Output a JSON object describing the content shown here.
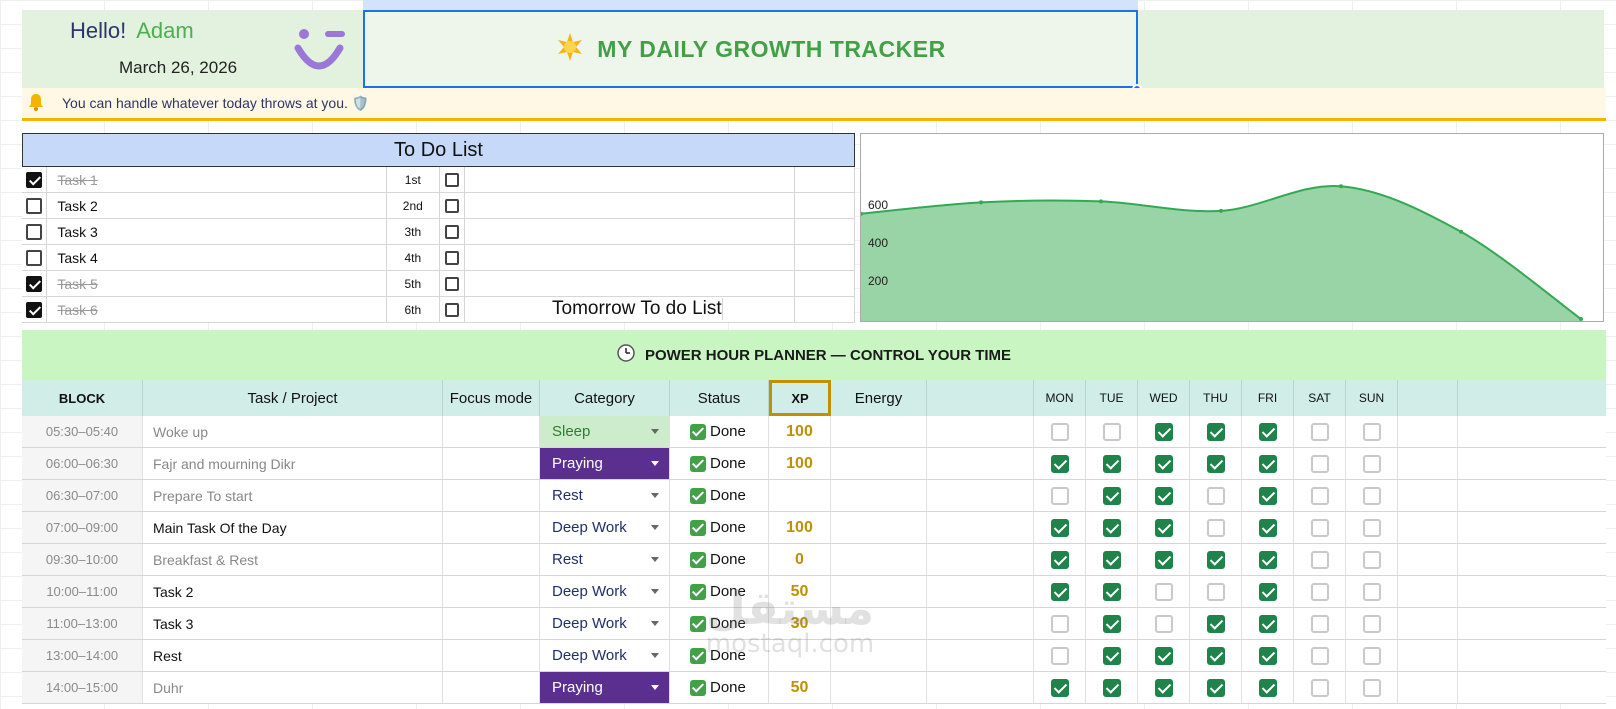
{
  "header": {
    "greeting": "Hello!",
    "name": "Adam",
    "date": "March 26, 2026",
    "title": "MY DAILY GROWTH TRACKER",
    "title_icon": "sun-icon",
    "motivation": "You can handle whatever today throws at you. 🛡️"
  },
  "todo": {
    "title": "To Do List",
    "tomorrow_title": "Tomorrow To do List",
    "items": [
      {
        "label": "Task 1",
        "order": "1st",
        "done": true
      },
      {
        "label": "Task 2",
        "order": "2nd",
        "done": false
      },
      {
        "label": "Task 3",
        "order": "3th",
        "done": false
      },
      {
        "label": "Task 4",
        "order": "4th",
        "done": false
      },
      {
        "label": "Task 5",
        "order": "5th",
        "done": true
      },
      {
        "label": "Task 6",
        "order": "6th",
        "done": true
      }
    ]
  },
  "chart_data": {
    "type": "area",
    "x": [
      1,
      2,
      3,
      4,
      5,
      6,
      7
    ],
    "series": [
      {
        "values": [
          555,
          615,
          620,
          570,
          700,
          460,
          0
        ]
      }
    ],
    "yticks": [
      "200",
      "400",
      "600"
    ],
    "ylim": [
      0,
      800
    ],
    "grid": false,
    "colors": {
      "fill": "#98d4a6",
      "line": "#34a853"
    }
  },
  "planner": {
    "banner": "POWER HOUR PLANNER  —  CONTROL YOUR TIME",
    "banner_icon": "clock-icon",
    "columns": {
      "block": "BLOCK",
      "task": "Task / Project",
      "focus": "Focus mode",
      "category": "Category",
      "status": "Status",
      "xp": "XP",
      "energy": "Energy",
      "days": [
        "MON",
        "TUE",
        "WED",
        "THU",
        "FRI",
        "SAT",
        "SUN"
      ]
    },
    "rows": [
      {
        "block": "05:30–05:40",
        "task": "Woke up",
        "strong": false,
        "category": "Sleep",
        "cat_style": "sleep",
        "status": "Done",
        "xp": "100",
        "days": [
          false,
          false,
          true,
          true,
          true,
          false,
          false
        ]
      },
      {
        "block": "06:00–06:30",
        "task": "Fajr and mourning Dikr",
        "strong": false,
        "category": "Praying",
        "cat_style": "praying",
        "status": "Done",
        "xp": "100",
        "days": [
          true,
          true,
          true,
          true,
          true,
          false,
          false
        ]
      },
      {
        "block": "06:30–07:00",
        "task": "Prepare To start",
        "strong": false,
        "category": "Rest",
        "cat_style": "plain",
        "status": "Done",
        "xp": "",
        "days": [
          false,
          true,
          true,
          false,
          true,
          false,
          false
        ]
      },
      {
        "block": "07:00–09:00",
        "task": "Main Task Of the Day",
        "strong": true,
        "category": "Deep Work",
        "cat_style": "plain",
        "status": "Done",
        "xp": "100",
        "days": [
          true,
          true,
          true,
          false,
          true,
          false,
          false
        ]
      },
      {
        "block": "09:30–10:00",
        "task": "Breakfast & Rest",
        "strong": false,
        "category": "Rest",
        "cat_style": "plain",
        "status": "Done",
        "xp": "0",
        "days": [
          true,
          true,
          true,
          true,
          true,
          false,
          false
        ]
      },
      {
        "block": "10:00–11:00",
        "task": "Task 2",
        "strong": true,
        "category": "Deep Work",
        "cat_style": "plain",
        "status": "Done",
        "xp": "50",
        "days": [
          true,
          true,
          false,
          false,
          true,
          false,
          false
        ]
      },
      {
        "block": "11:00–13:00",
        "task": "Task 3",
        "strong": true,
        "category": "Deep Work",
        "cat_style": "plain",
        "status": "Done",
        "xp": "30",
        "days": [
          false,
          true,
          false,
          true,
          true,
          false,
          false
        ]
      },
      {
        "block": "13:00–14:00",
        "task": "Rest",
        "strong": true,
        "category": "Deep Work",
        "cat_style": "plain",
        "status": "Done",
        "xp": "",
        "days": [
          false,
          true,
          true,
          true,
          true,
          false,
          false
        ]
      },
      {
        "block": "14:00–15:00",
        "task": "Duhr",
        "strong": false,
        "category": "Praying",
        "cat_style": "praying",
        "status": "Done",
        "xp": "50",
        "days": [
          true,
          true,
          true,
          true,
          true,
          false,
          false
        ]
      }
    ]
  },
  "watermark": {
    "arabic": "مستقل",
    "latin": "mostaql.com"
  },
  "colors": {
    "accent_green": "#43a047",
    "xp_gold": "#bf9000",
    "praying_purple": "#5b2f8f",
    "checked_green": "#1e8449"
  }
}
